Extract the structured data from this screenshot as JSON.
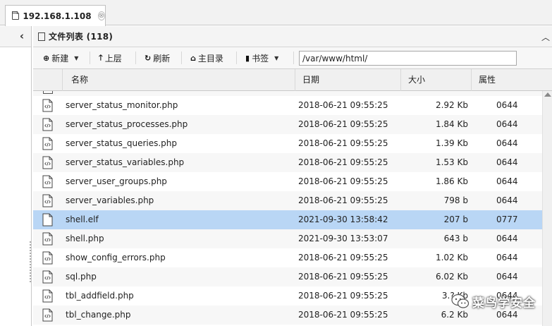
{
  "tab": {
    "title": "192.168.1.108",
    "close_glyph": "⊗"
  },
  "left_panel": {
    "collapse_glyph": "‹"
  },
  "panel": {
    "title": "文件列表 (118)",
    "up_glyph": "︿"
  },
  "toolbar": {
    "new_label": "新建",
    "up_label": "上层",
    "refresh_label": "刷新",
    "home_label": "主目录",
    "bookmark_label": "书签",
    "path_value": "/var/www/html/"
  },
  "columns": {
    "name": "名称",
    "date": "日期",
    "size": "大小",
    "attr": "属性"
  },
  "files": [
    {
      "name": "server_status_monitor.php",
      "date": "2018-06-21 09:55:25",
      "size": "2.92 Kb",
      "attr": "0644",
      "icon": "php-file-icon"
    },
    {
      "name": "server_status_processes.php",
      "date": "2018-06-21 09:55:25",
      "size": "1.84 Kb",
      "attr": "0644",
      "icon": "php-file-icon"
    },
    {
      "name": "server_status_queries.php",
      "date": "2018-06-21 09:55:25",
      "size": "1.39 Kb",
      "attr": "0644",
      "icon": "php-file-icon"
    },
    {
      "name": "server_status_variables.php",
      "date": "2018-06-21 09:55:25",
      "size": "1.53 Kb",
      "attr": "0644",
      "icon": "php-file-icon"
    },
    {
      "name": "server_user_groups.php",
      "date": "2018-06-21 09:55:25",
      "size": "1.86 Kb",
      "attr": "0644",
      "icon": "php-file-icon"
    },
    {
      "name": "server_variables.php",
      "date": "2018-06-21 09:55:25",
      "size": "798 b",
      "attr": "0644",
      "icon": "php-file-icon"
    },
    {
      "name": "shell.elf",
      "date": "2021-09-30 13:58:42",
      "size": "207 b",
      "attr": "0777",
      "icon": "plain-file-icon",
      "selected": true
    },
    {
      "name": "shell.php",
      "date": "2021-09-30 13:53:07",
      "size": "643 b",
      "attr": "0644",
      "icon": "php-file-icon"
    },
    {
      "name": "show_config_errors.php",
      "date": "2018-06-21 09:55:25",
      "size": "1.02 Kb",
      "attr": "0644",
      "icon": "php-file-icon"
    },
    {
      "name": "sql.php",
      "date": "2018-06-21 09:55:25",
      "size": "6.02 Kb",
      "attr": "0644",
      "icon": "php-file-icon"
    },
    {
      "name": "tbl_addfield.php",
      "date": "2018-06-21 09:55:25",
      "size": "3.? Kb",
      "attr": "0644",
      "icon": "php-file-icon"
    },
    {
      "name": "tbl_change.php",
      "date": "2018-06-21 09:55:25",
      "size": "6.2 Kb",
      "attr": "0644",
      "icon": "php-file-icon"
    }
  ],
  "watermark": {
    "text": "菜鸟学安全",
    "icon": "wechat-icon"
  },
  "colors": {
    "selected_row": "#b9d6f5",
    "striped_row": "#f7f7f7",
    "header_bg": "#f0f0f0"
  }
}
